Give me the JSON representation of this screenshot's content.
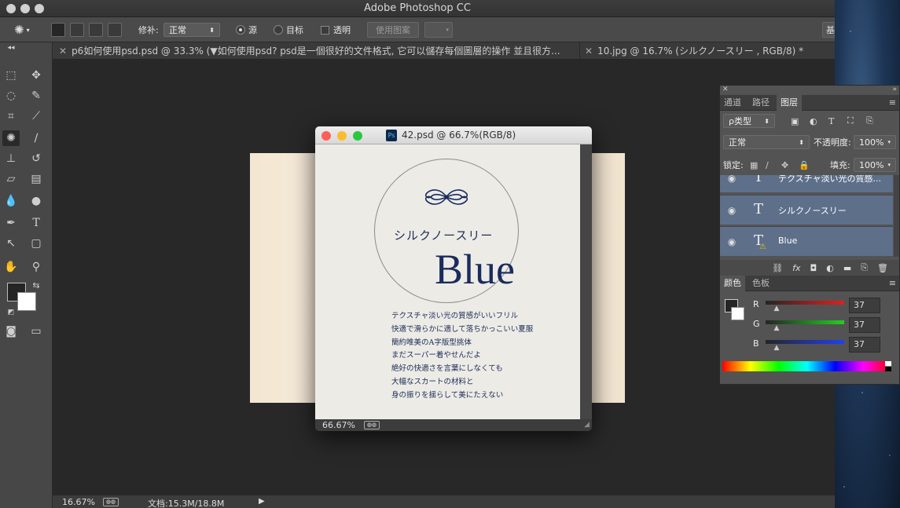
{
  "app": {
    "title": "Adobe Photoshop CC"
  },
  "options_bar": {
    "feather_label": "修补:",
    "mode_value": "正常",
    "source_label": "源",
    "destination_label": "目标",
    "transparent_label": "透明",
    "use_pattern_label": "使用图案",
    "right_btn_partial": "基"
  },
  "tabs": [
    {
      "label": "p6如何使用psd.psd @ 33.3% (▼如何使用psd?  psd是一個很好的文件格式, 它可以儲存每個圖層的操作 並且很方..."
    },
    {
      "label": "10.jpg @ 16.7% (シルクノースリー , RGB/8) *"
    }
  ],
  "doc_window": {
    "title": "42.psd @ 66.7%(RGB/8)",
    "zoom": "66.67%",
    "jp_title": "シルクノースリー",
    "big_text": "Blue",
    "body_lines": [
      "テクスチャ淡い光の質感がいいフリル",
      "快適で滑らかに適して落ちかっこいい夏服",
      "簡約唯美のA字版型挑体",
      "まだスーパー着やせんだよ",
      "絶好の快適さを言葉にしなくても",
      "大幅なスカートの材料と",
      "身の振りを揺らして美にたえない"
    ]
  },
  "layers_panel": {
    "tabs": [
      "通道",
      "路径",
      "图层"
    ],
    "filter_label": "ρ类型",
    "blend_mode": "正常",
    "opacity_label": "不透明度:",
    "opacity_value": "100%",
    "lock_label": "锁定:",
    "fill_label": "填充:",
    "fill_value": "100%",
    "layers": [
      {
        "name": "テクスチャ淡い光の質感..."
      },
      {
        "name": "シルクノースリー"
      },
      {
        "name": "Blue"
      }
    ]
  },
  "color_panel": {
    "tabs": [
      "颜色",
      "色板"
    ],
    "r_label": "R",
    "g_label": "G",
    "b_label": "B",
    "r_value": "37",
    "g_value": "37",
    "b_value": "37",
    "slider_fraction": 0.145
  },
  "status_bar": {
    "zoom": "16.67%",
    "doc_info": "文档:15.3M/18.8M"
  },
  "colors": {
    "layer_selected": "#5e6f8a",
    "text_navy": "#1b2b5e"
  }
}
